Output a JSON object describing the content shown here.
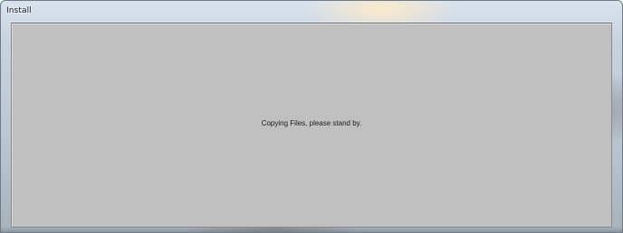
{
  "window": {
    "title": "Install"
  },
  "content": {
    "status_message": "Copying Files, please stand by."
  },
  "colors": {
    "client_background": "#c0c0c0",
    "text": "#202020"
  }
}
